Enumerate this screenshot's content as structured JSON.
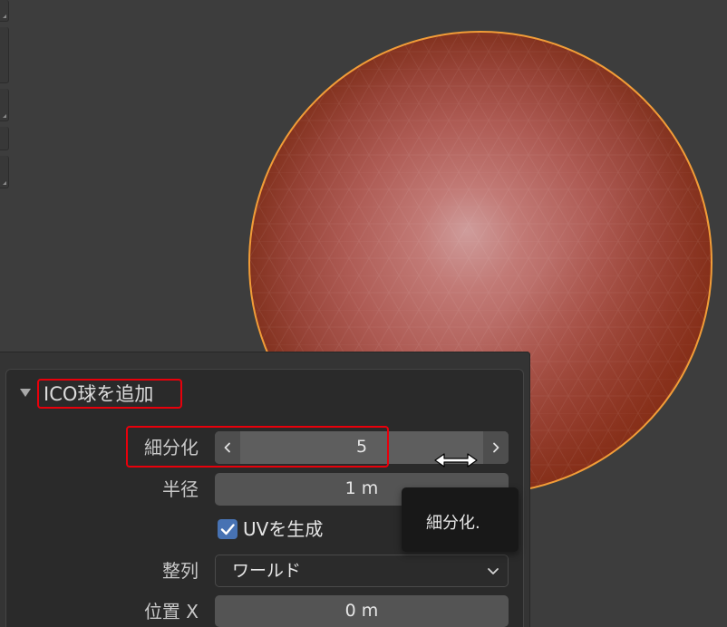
{
  "colors": {
    "viewport_background": "#3d3d3d",
    "selection_outline": "#f29d38",
    "accent": "#4772b3",
    "annotation": "#e8000b",
    "panel_background": "#2a2a2a",
    "field_background": "#545454",
    "text": "#e6e6e6",
    "label_text": "#c8c8c8"
  },
  "toolbar": {
    "segment_icons": [
      "tool-variant-corner-icon",
      "tool-variant-corner-icon",
      "tool-variant-corner-icon"
    ]
  },
  "panel": {
    "collapse_icon": "triangle-down-icon",
    "title": "ICO球を追加",
    "fields": {
      "subdivisions": {
        "label": "細分化",
        "value": "5",
        "decrement_icon": "chevron-left-icon",
        "increment_icon": "chevron-right-icon"
      },
      "radius": {
        "label": "半径",
        "value": "1 m"
      },
      "generate_uvs": {
        "label": "UVを生成",
        "checked": true,
        "icon": "checkmark-icon"
      },
      "align": {
        "label": "整列",
        "value": "ワールド",
        "icon": "chevron-down-icon"
      },
      "location_x": {
        "label": "位置 X",
        "value": "0 m"
      }
    }
  },
  "tooltip": {
    "text": "細分化."
  },
  "cursor": {
    "icon": "horizontal-resize-cursor-icon"
  }
}
